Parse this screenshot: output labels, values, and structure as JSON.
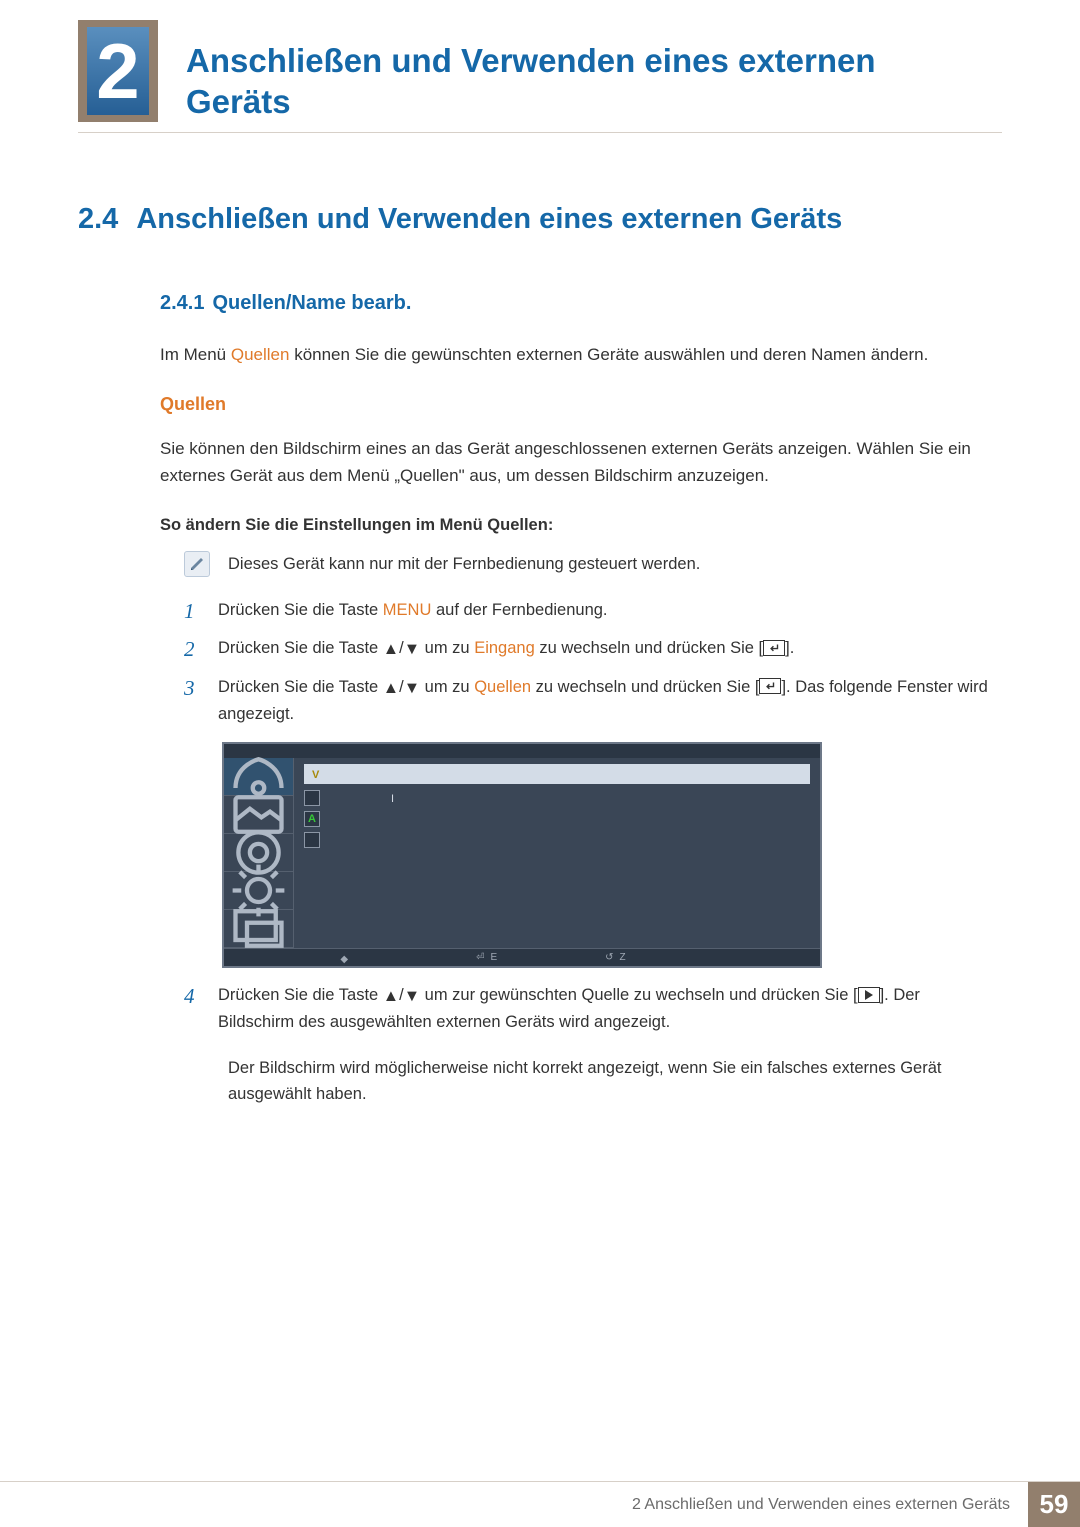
{
  "chapter": {
    "number": "2",
    "title": "Anschließen und Verwenden eines externen Geräts"
  },
  "section": {
    "number": "2.4",
    "title": "Anschließen und Verwenden eines externen Geräts"
  },
  "subsection": {
    "number": "2.4.1",
    "title": "Quellen/Name bearb."
  },
  "intro": {
    "prefix": "Im Menü ",
    "keyword": "Quellen",
    "suffix": " können Sie die gewünschten externen Geräte auswählen und deren Namen ändern."
  },
  "quellen_heading": "Quellen",
  "quellen_para": "Sie können den Bildschirm eines an das Gerät angeschlossenen externen Geräts anzeigen. Wählen Sie ein externes Gerät aus dem Menü „Quellen\" aus, um dessen Bildschirm anzuzeigen.",
  "howto_heading": "So ändern Sie die Einstellungen im Menü Quellen:",
  "note1": "Dieses Gerät kann nur mit der Fernbedienung gesteuert werden.",
  "steps": [
    {
      "num": "1",
      "t1": "Drücken Sie die Taste ",
      "kw": "MENU",
      "t2": " auf der Fernbedienung."
    },
    {
      "num": "2",
      "t1": "Drücken Sie die Taste ",
      "mid": " um zu ",
      "kw": "Eingang",
      "t2": " zu wechseln und drücken Sie [",
      "t3": "]."
    },
    {
      "num": "3",
      "t1": "Drücken Sie die Taste ",
      "mid": " um zu ",
      "kw": "Quellen",
      "t2": " zu wechseln und drücken Sie [",
      "t3": "]. Das folgende Fenster wird angezeigt."
    },
    {
      "num": "4",
      "t1": "Drücken Sie die Taste ",
      "mid": " um zur gewünschten Quelle zu wechseln und drücken Sie [",
      "t3": "]. Der Bildschirm des ausgewählten externen Geräts wird angezeigt."
    }
  ],
  "note2": "Der Bildschirm wird möglicherweise nicht korrekt angezeigt, wenn Sie ein falsches externes Gerät ausgewählt haben.",
  "osd": {
    "selected_prefix": "V",
    "row2_prefix": "A",
    "bottom_enter": "E",
    "bottom_back": "Z"
  },
  "footer": {
    "text": "2 Anschließen und Verwenden eines externen Geräts",
    "page": "59"
  }
}
